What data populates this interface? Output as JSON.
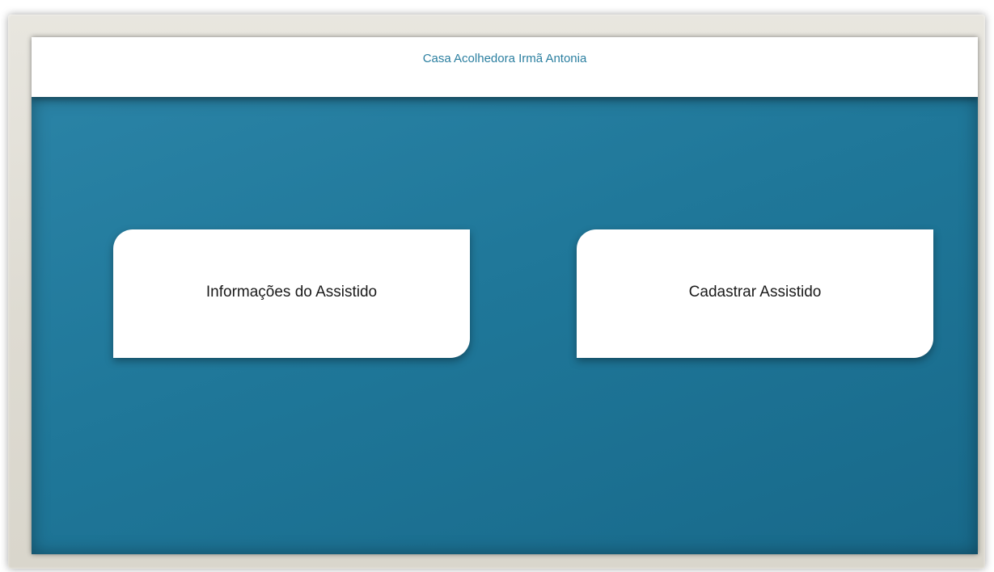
{
  "app": {
    "title": "Casa Acolhedora Irmã Antonia"
  },
  "actions": {
    "info_label": "Informações do Assistido",
    "register_label": "Cadastrar Assistido"
  },
  "colors": {
    "accent": "#2b7fa0",
    "body_background": "#1f7799",
    "card_background": "#ffffff",
    "bezel": "#e2dfd7"
  }
}
